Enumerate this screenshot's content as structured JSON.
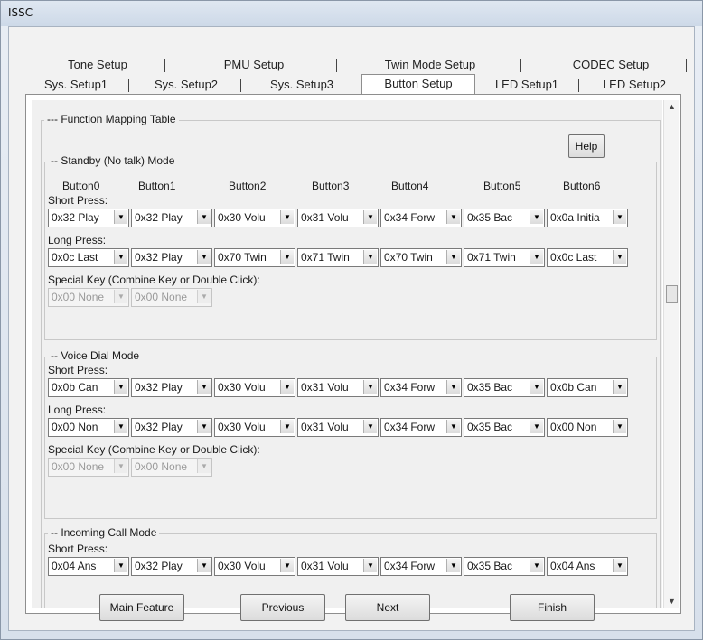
{
  "window": {
    "title": "ISSC"
  },
  "tabs": {
    "row1": [
      "Tone Setup",
      "PMU Setup",
      "Twin Mode Setup",
      "CODEC Setup"
    ],
    "row2": [
      "Sys. Setup1",
      "Sys. Setup2",
      "Sys. Setup3",
      "Button Setup",
      "LED Setup1",
      "LED Setup2"
    ],
    "active": "Button Setup"
  },
  "panel": {
    "function_table_title": "--- Function Mapping Table",
    "help_label": "Help",
    "button_headers": [
      "Button0",
      "Button1",
      "Button2",
      "Button3",
      "Button4",
      "Button5",
      "Button6"
    ],
    "short_press_label": "Short Press:",
    "long_press_label": "Long Press:",
    "special_key_label": "Special Key (Combine Key or Double Click):",
    "standby": {
      "title": "-- Standby (No talk) Mode",
      "short": [
        "0x32 Play",
        "0x32 Play",
        "0x30 Volu",
        "0x31 Volu",
        "0x34 Forw",
        "0x35 Bac",
        "0x0a Initia"
      ],
      "long": [
        "0x0c Last",
        "0x32 Play",
        "0x70 Twin",
        "0x71 Twin",
        "0x70 Twin",
        "0x71 Twin",
        "0x0c Last"
      ],
      "special": [
        "0x00 None",
        "0x00 None"
      ]
    },
    "voice_dial": {
      "title": "-- Voice Dial Mode",
      "short": [
        "0x0b Can",
        "0x32 Play",
        "0x30 Volu",
        "0x31 Volu",
        "0x34 Forw",
        "0x35 Bac",
        "0x0b Can"
      ],
      "long": [
        "0x00 Non",
        "0x32 Play",
        "0x30 Volu",
        "0x31 Volu",
        "0x34 Forw",
        "0x35 Bac",
        "0x00 Non"
      ],
      "special": [
        "0x00 None",
        "0x00 None"
      ]
    },
    "incoming_call": {
      "title": "-- Incoming Call Mode",
      "short": [
        "0x04 Ans",
        "0x32 Play",
        "0x30 Volu",
        "0x31 Volu",
        "0x34 Forw",
        "0x35 Bac",
        "0x04 Ans"
      ]
    }
  },
  "footer": {
    "main_feature": "Main Feature",
    "previous": "Previous",
    "next": "Next",
    "finish": "Finish"
  }
}
